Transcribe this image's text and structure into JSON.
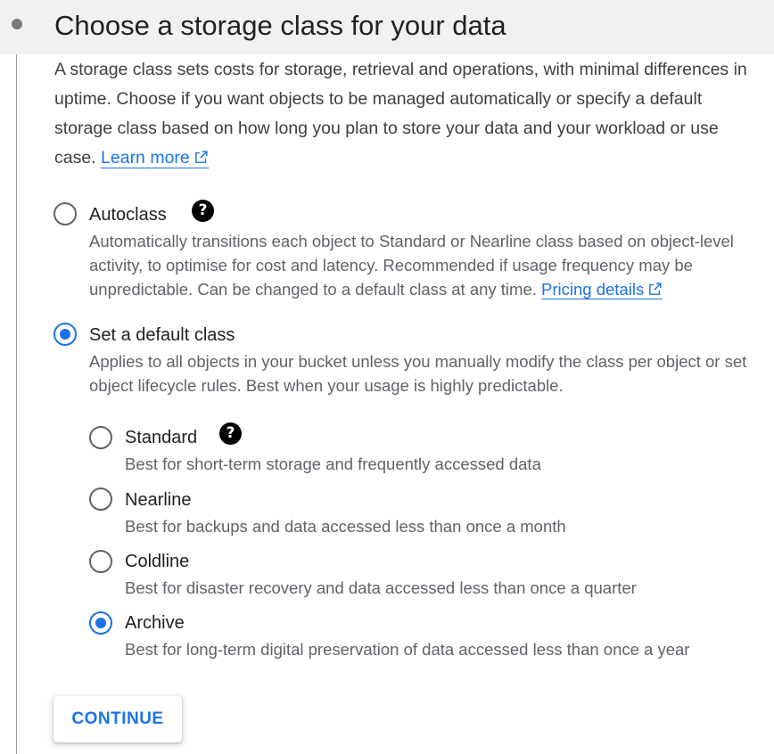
{
  "section": {
    "title": "Choose a storage class for your data",
    "intro": "A storage class sets costs for storage, retrieval and operations, with minimal differences in uptime. Choose if you want objects to be managed automatically or specify a default storage class based on how long you plan to store your data and your workload or use case.",
    "learn_more": "Learn more"
  },
  "options": {
    "autoclass": {
      "label": "Autoclass",
      "selected": false,
      "description": "Automatically transitions each object to Standard or Nearline class based on object-level activity, to optimise for cost and latency. Recommended if usage frequency may be unpredictable. Can be changed to a default class at any time.",
      "link": "Pricing details"
    },
    "default_class": {
      "label": "Set a default class",
      "selected": true,
      "description": "Applies to all objects in your bucket unless you manually modify the class per object or set object lifecycle rules. Best when your usage is highly predictable.",
      "classes": [
        {
          "label": "Standard",
          "description": "Best for short-term storage and frequently accessed data",
          "selected": false
        },
        {
          "label": "Nearline",
          "description": "Best for backups and data accessed less than once a month",
          "selected": false
        },
        {
          "label": "Coldline",
          "description": "Best for disaster recovery and data accessed less than once a quarter",
          "selected": false
        },
        {
          "label": "Archive",
          "description": "Best for long-term digital preservation of data accessed less than once a year",
          "selected": true
        }
      ]
    }
  },
  "help_icon_glyph": "?",
  "continue_label": "CONTINUE",
  "colors": {
    "accent": "#1a73e8",
    "header_bg": "#f1f1f1",
    "text_secondary": "#5f6368"
  }
}
